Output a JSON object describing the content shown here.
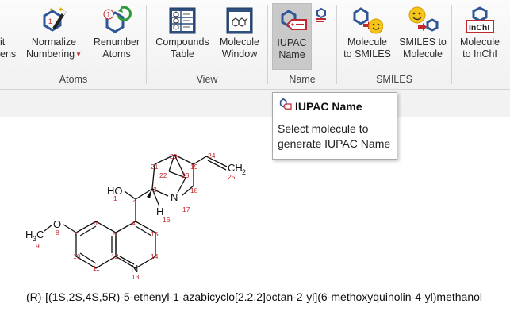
{
  "ribbon": {
    "buttons": {
      "edit_partial": "it",
      "edit_partial2": "ens",
      "normalize_line1": "Normalize",
      "normalize_line2": "Numbering",
      "renumber_line1": "Renumber",
      "renumber_line2": "Atoms",
      "compounds_line1": "Compounds",
      "compounds_line2": "Table",
      "molwin_line1": "Molecule",
      "molwin_line2": "Window",
      "iupac_line1": "IUPAC",
      "iupac_line2": "Name",
      "mol2smiles_line1": "Molecule",
      "mol2smiles_line2": "to SMILES",
      "smiles2mol_line1": "SMILES to",
      "smiles2mol_line2": "Molecule",
      "mol2inchi_line1": "Molecule",
      "mol2inchi_line2": "to InChI",
      "inchi_badge": "InChI",
      "renumber_badge": "1"
    },
    "groups": {
      "atoms": "Atoms",
      "view": "View",
      "name": "Name",
      "smiles": "SMILES"
    }
  },
  "tooltip": {
    "title": "IUPAC Name",
    "description": "Select molecule to generate IUPAC Name"
  },
  "molecule": {
    "iupac_name": "(R)-[(1S,2S,4S,5R)-5-ethenyl-1-azabicyclo[2.2.2]octan-2-yl](6-methoxyquinolin-4-yl)methanol",
    "atom_labels": {
      "ho": "HO",
      "h": "H",
      "n_bridge": "N",
      "n_ring": "N",
      "o": "O",
      "h3c_h": "H",
      "h3c_3": "3",
      "h3c_c": "C",
      "ch2_ch": "CH",
      "ch2_2": "2"
    },
    "atom_numbers": [
      "1",
      "2",
      "3",
      "4",
      "5",
      "6",
      "7",
      "8",
      "9",
      "10",
      "11",
      "12",
      "13",
      "14",
      "15",
      "16",
      "17",
      "18",
      "19",
      "20",
      "21",
      "22",
      "23",
      "24",
      "25"
    ]
  },
  "colors": {
    "accent_red": "#c0282d",
    "icon_blue": "#2f5597",
    "atom_number": "#c0282d"
  }
}
